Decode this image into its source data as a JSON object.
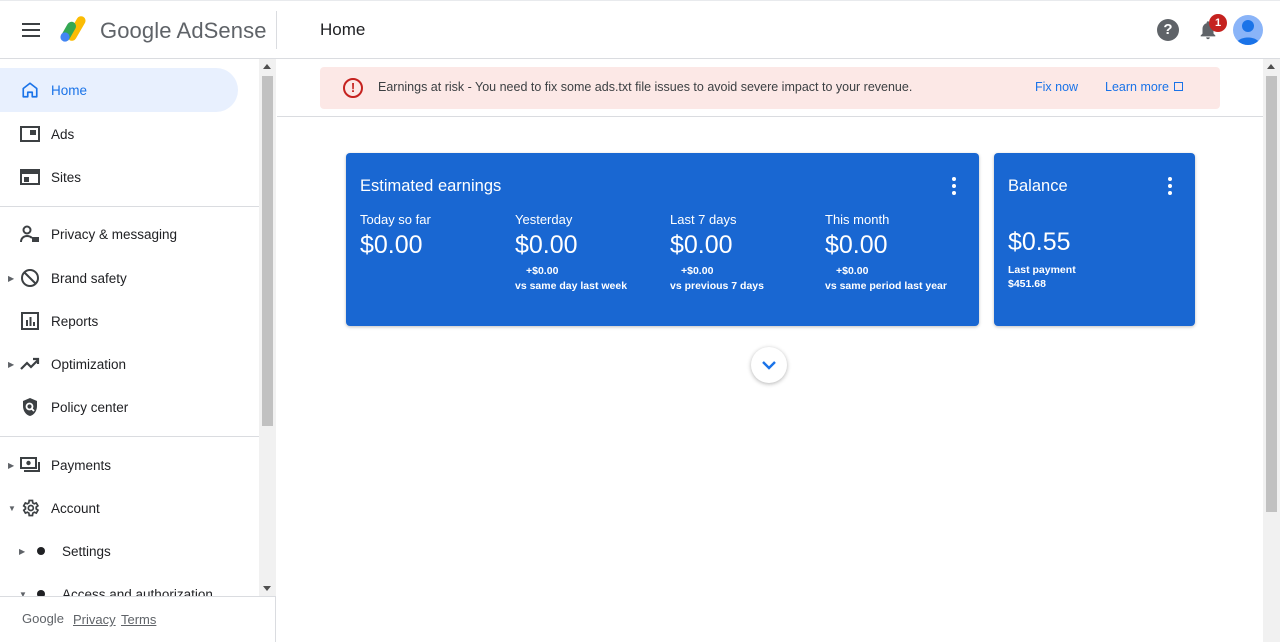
{
  "header": {
    "brand_google": "Google",
    "brand_product": "AdSense",
    "page_title": "Home",
    "help_glyph": "?",
    "notification_count": "1"
  },
  "sidebar": {
    "items": [
      {
        "label": "Home",
        "icon": "home-icon",
        "active": true
      },
      {
        "label": "Ads",
        "icon": "ads-icon"
      },
      {
        "label": "Sites",
        "icon": "sites-icon"
      },
      {
        "label": "Privacy & messaging",
        "icon": "privacy-icon"
      },
      {
        "label": "Brand safety",
        "icon": "block-icon"
      },
      {
        "label": "Reports",
        "icon": "reports-icon"
      },
      {
        "label": "Optimization",
        "icon": "trending-up-icon"
      },
      {
        "label": "Policy center",
        "icon": "shield-icon"
      },
      {
        "label": "Payments",
        "icon": "payments-icon"
      },
      {
        "label": "Account",
        "icon": "gear-icon"
      }
    ],
    "sub_items": [
      {
        "label": "Settings"
      },
      {
        "label": "Access and authorization"
      }
    ],
    "footer": {
      "google": "Google",
      "privacy": "Privacy",
      "terms": "Terms"
    }
  },
  "banner": {
    "error_glyph": "!",
    "message": "Earnings at risk - You need to fix some ads.txt file issues to avoid severe impact to your revenue.",
    "fix_now": "Fix now",
    "learn_more": "Learn more"
  },
  "earnings_card": {
    "title": "Estimated earnings",
    "metrics": [
      {
        "label": "Today so far",
        "value": "$0.00",
        "delta": "",
        "compare": ""
      },
      {
        "label": "Yesterday",
        "value": "$0.00",
        "delta": "+$0.00",
        "compare": "vs same day last week"
      },
      {
        "label": "Last 7 days",
        "value": "$0.00",
        "delta": "+$0.00",
        "compare": "vs previous 7 days"
      },
      {
        "label": "This month",
        "value": "$0.00",
        "delta": "+$0.00",
        "compare": "vs same period last year"
      }
    ]
  },
  "balance_card": {
    "title": "Balance",
    "value": "$0.55",
    "last_payment_label": "Last payment",
    "last_payment_value": "$451.68"
  },
  "colors": {
    "card_blue": "#1967d2",
    "accent": "#1a73e8",
    "banner_bg": "#fce8e6",
    "error": "#c5221f"
  }
}
